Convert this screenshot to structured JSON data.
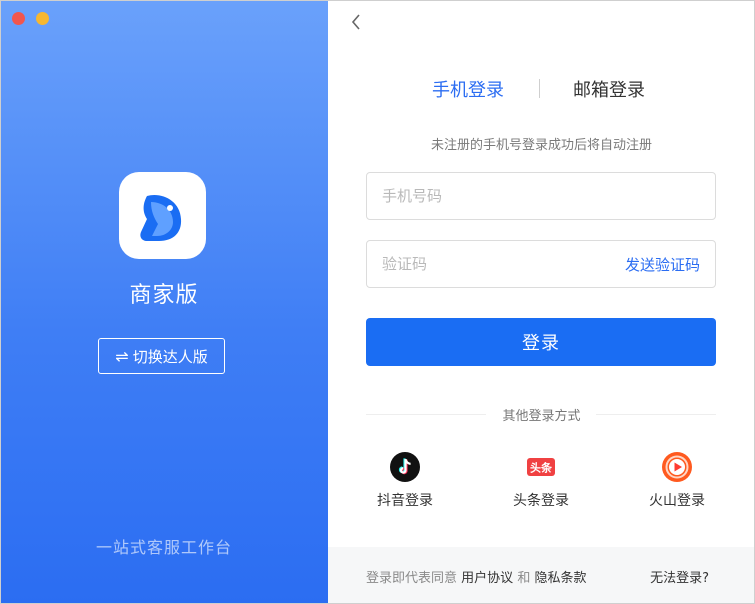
{
  "left_panel": {
    "brand_name": "商家版",
    "switch_label": "切换达人版",
    "switch_icon": "⇌",
    "tagline": "一站式客服工作台",
    "gradient_top": "#6aa1fb",
    "gradient_bottom": "#2b6df2"
  },
  "login": {
    "tabs": [
      {
        "label": "手机登录",
        "active": true
      },
      {
        "label": "邮箱登录",
        "active": false
      }
    ],
    "hint": "未注册的手机号登录成功后将自动注册",
    "phone": {
      "value": "",
      "placeholder": "手机号码"
    },
    "code": {
      "value": "",
      "placeholder": "验证码"
    },
    "send_code_label": "发送验证码",
    "submit_label": "登录",
    "accent": "#1a6df3"
  },
  "other_login": {
    "title": "其他登录方式",
    "items": [
      {
        "label": "抖音登录",
        "icon": "douyin-icon"
      },
      {
        "label": "头条登录",
        "icon": "toutiao-icon"
      },
      {
        "label": "火山登录",
        "icon": "huoshan-icon"
      }
    ]
  },
  "footer": {
    "agree_prefix": "登录即代表同意",
    "user_agreement": "用户协议",
    "and": "和",
    "privacy_policy": "隐私条款",
    "cant_login": "无法登录?"
  }
}
